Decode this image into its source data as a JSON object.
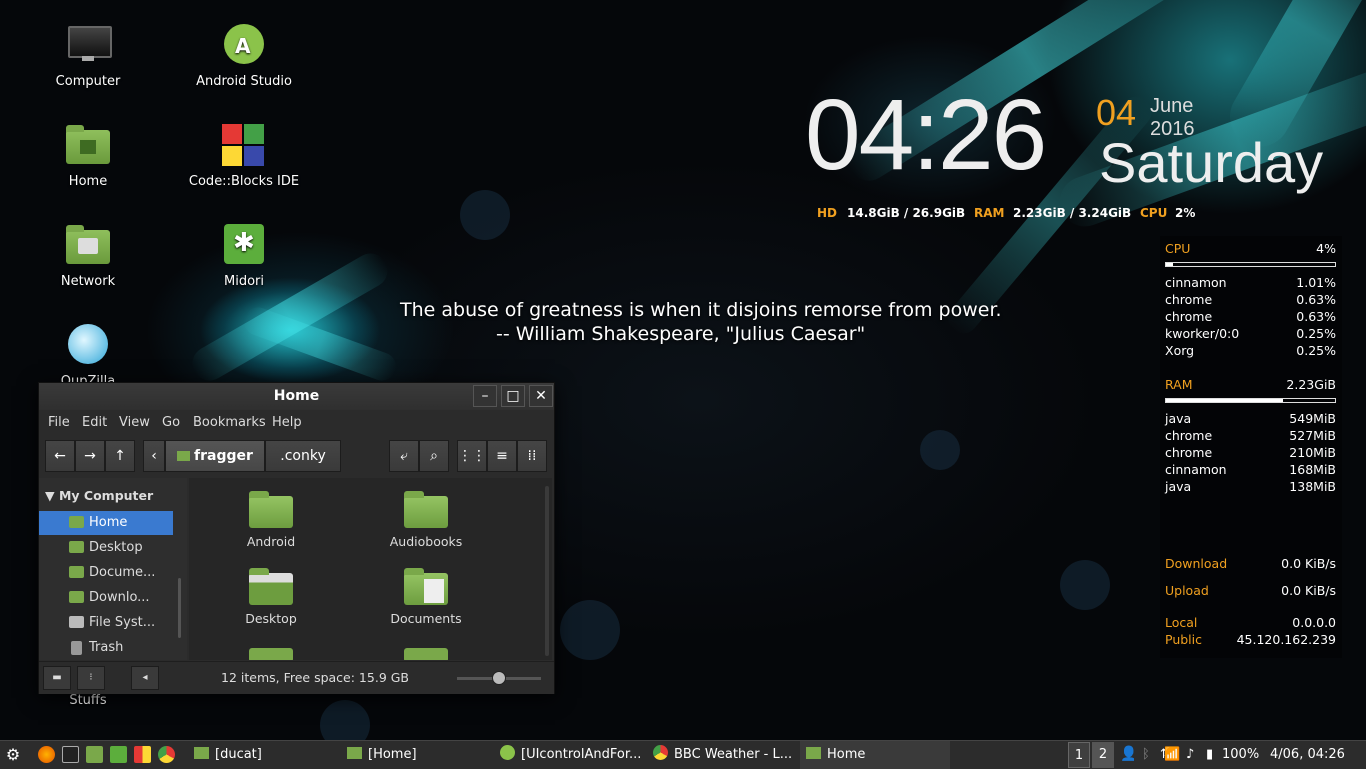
{
  "desktop_icons": [
    {
      "label": "Computer"
    },
    {
      "label": "Android Studio"
    },
    {
      "label": "Home"
    },
    {
      "label": "Code::Blocks IDE"
    },
    {
      "label": "Network"
    },
    {
      "label": "Midori"
    },
    {
      "label": "QupZilla"
    },
    {
      "label": "Stuffs"
    }
  ],
  "clock": {
    "time": "04:26",
    "day": "04",
    "month_year": "June 2016",
    "weekday": "Saturday"
  },
  "stats": {
    "hd_label": "HD",
    "hd_value": "14.8GiB / 26.9GiB",
    "ram_label": "RAM",
    "ram_value": "2.23GiB / 3.24GiB",
    "cpu_label": "CPU",
    "cpu_value": "2%"
  },
  "conky": {
    "cpu_label": "CPU",
    "cpu_value": "4%",
    "cpu_fraction": 0.04,
    "cpu_procs": [
      {
        "name": "cinnamon",
        "value": "1.01%"
      },
      {
        "name": "chrome",
        "value": "0.63%"
      },
      {
        "name": "chrome",
        "value": "0.63%"
      },
      {
        "name": "kworker/0:0",
        "value": "0.25%"
      },
      {
        "name": "Xorg",
        "value": "0.25%"
      }
    ],
    "ram_label": "RAM",
    "ram_value": "2.23GiB",
    "ram_fraction": 0.69,
    "ram_procs": [
      {
        "name": "java",
        "value": "549MiB"
      },
      {
        "name": "chrome",
        "value": "527MiB"
      },
      {
        "name": "chrome",
        "value": "210MiB"
      },
      {
        "name": "cinnamon",
        "value": "168MiB"
      },
      {
        "name": "java",
        "value": "138MiB"
      }
    ],
    "download_label": "Download",
    "download_value": "0.0 KiB/s",
    "upload_label": "Upload",
    "upload_value": "0.0 KiB/s",
    "local_label": "Local",
    "local_value": "0.0.0.0",
    "public_label": "Public",
    "public_value": "45.120.162.239"
  },
  "quote": {
    "line1": "The abuse of greatness is when it disjoins remorse from power.",
    "line2": "-- William Shakespeare, \"Julius Caesar\""
  },
  "window": {
    "title": "Home",
    "menu": [
      "File",
      "Edit",
      "View",
      "Go",
      "Bookmarks",
      "Help"
    ],
    "path": [
      "fragger",
      ".conky"
    ],
    "sidebar_header": "My Computer",
    "sidebar_items": [
      "Home",
      "Desktop",
      "Docume...",
      "Downlo...",
      "File Syst...",
      "Trash"
    ],
    "files": [
      "Android",
      "Audiobooks",
      "Desktop",
      "Documents"
    ],
    "status": "12 items, Free space: 15.9 GB"
  },
  "taskbar": {
    "items": [
      "[ducat]",
      "[Home]",
      "[UIcontrolAndFor...",
      "BBC Weather - L...",
      "Home"
    ],
    "workspaces": [
      "1",
      "2"
    ],
    "battery": "100%",
    "datetime": "4/06, 04:26"
  }
}
